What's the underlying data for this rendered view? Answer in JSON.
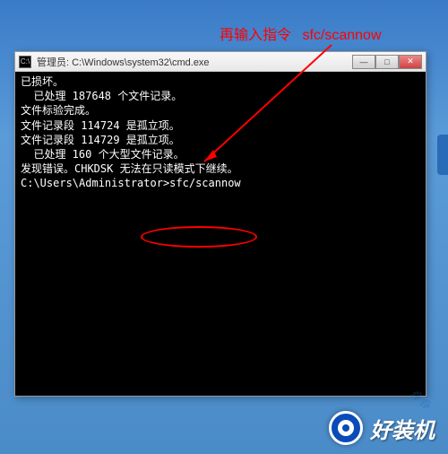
{
  "annotation": {
    "text": "再输入指令",
    "command": "sfc/scannow"
  },
  "window": {
    "title": "管理员: C:\\Windows\\system32\\cmd.exe",
    "controls": {
      "min": "—",
      "max": "□",
      "close": "✕"
    }
  },
  "cmd": {
    "lines": [
      "已损坏。",
      "  已处理 187648 个文件记录。",
      "文件标验完成。",
      "文件记录段 114724 是孤立项。",
      "文件记录段 114729 是孤立项。",
      "  已处理 160 个大型文件记录。",
      "",
      "发现错误。CHKDSK 无法在只读模式下继续。",
      "",
      "C:\\Users\\Administrator>sfc/scannow"
    ]
  },
  "watermark": {
    "text": "好装机"
  }
}
